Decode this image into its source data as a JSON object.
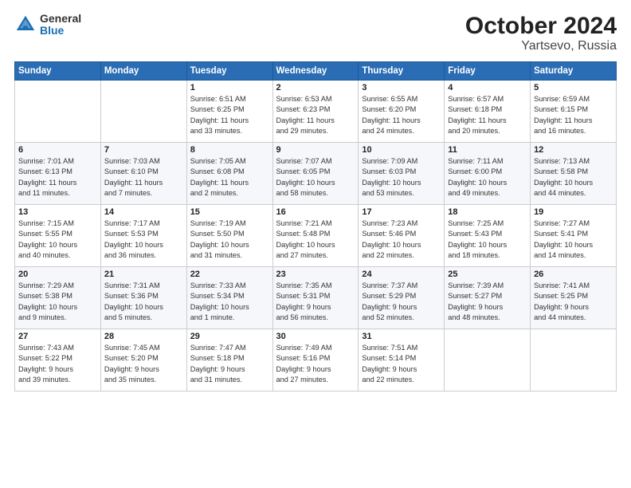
{
  "header": {
    "logo_general": "General",
    "logo_blue": "Blue",
    "title": "October 2024",
    "location": "Yartsevo, Russia"
  },
  "weekdays": [
    "Sunday",
    "Monday",
    "Tuesday",
    "Wednesday",
    "Thursday",
    "Friday",
    "Saturday"
  ],
  "weeks": [
    [
      {
        "day": "",
        "info": ""
      },
      {
        "day": "",
        "info": ""
      },
      {
        "day": "1",
        "info": "Sunrise: 6:51 AM\nSunset: 6:25 PM\nDaylight: 11 hours\nand 33 minutes."
      },
      {
        "day": "2",
        "info": "Sunrise: 6:53 AM\nSunset: 6:23 PM\nDaylight: 11 hours\nand 29 minutes."
      },
      {
        "day": "3",
        "info": "Sunrise: 6:55 AM\nSunset: 6:20 PM\nDaylight: 11 hours\nand 24 minutes."
      },
      {
        "day": "4",
        "info": "Sunrise: 6:57 AM\nSunset: 6:18 PM\nDaylight: 11 hours\nand 20 minutes."
      },
      {
        "day": "5",
        "info": "Sunrise: 6:59 AM\nSunset: 6:15 PM\nDaylight: 11 hours\nand 16 minutes."
      }
    ],
    [
      {
        "day": "6",
        "info": "Sunrise: 7:01 AM\nSunset: 6:13 PM\nDaylight: 11 hours\nand 11 minutes."
      },
      {
        "day": "7",
        "info": "Sunrise: 7:03 AM\nSunset: 6:10 PM\nDaylight: 11 hours\nand 7 minutes."
      },
      {
        "day": "8",
        "info": "Sunrise: 7:05 AM\nSunset: 6:08 PM\nDaylight: 11 hours\nand 2 minutes."
      },
      {
        "day": "9",
        "info": "Sunrise: 7:07 AM\nSunset: 6:05 PM\nDaylight: 10 hours\nand 58 minutes."
      },
      {
        "day": "10",
        "info": "Sunrise: 7:09 AM\nSunset: 6:03 PM\nDaylight: 10 hours\nand 53 minutes."
      },
      {
        "day": "11",
        "info": "Sunrise: 7:11 AM\nSunset: 6:00 PM\nDaylight: 10 hours\nand 49 minutes."
      },
      {
        "day": "12",
        "info": "Sunrise: 7:13 AM\nSunset: 5:58 PM\nDaylight: 10 hours\nand 44 minutes."
      }
    ],
    [
      {
        "day": "13",
        "info": "Sunrise: 7:15 AM\nSunset: 5:55 PM\nDaylight: 10 hours\nand 40 minutes."
      },
      {
        "day": "14",
        "info": "Sunrise: 7:17 AM\nSunset: 5:53 PM\nDaylight: 10 hours\nand 36 minutes."
      },
      {
        "day": "15",
        "info": "Sunrise: 7:19 AM\nSunset: 5:50 PM\nDaylight: 10 hours\nand 31 minutes."
      },
      {
        "day": "16",
        "info": "Sunrise: 7:21 AM\nSunset: 5:48 PM\nDaylight: 10 hours\nand 27 minutes."
      },
      {
        "day": "17",
        "info": "Sunrise: 7:23 AM\nSunset: 5:46 PM\nDaylight: 10 hours\nand 22 minutes."
      },
      {
        "day": "18",
        "info": "Sunrise: 7:25 AM\nSunset: 5:43 PM\nDaylight: 10 hours\nand 18 minutes."
      },
      {
        "day": "19",
        "info": "Sunrise: 7:27 AM\nSunset: 5:41 PM\nDaylight: 10 hours\nand 14 minutes."
      }
    ],
    [
      {
        "day": "20",
        "info": "Sunrise: 7:29 AM\nSunset: 5:38 PM\nDaylight: 10 hours\nand 9 minutes."
      },
      {
        "day": "21",
        "info": "Sunrise: 7:31 AM\nSunset: 5:36 PM\nDaylight: 10 hours\nand 5 minutes."
      },
      {
        "day": "22",
        "info": "Sunrise: 7:33 AM\nSunset: 5:34 PM\nDaylight: 10 hours\nand 1 minute."
      },
      {
        "day": "23",
        "info": "Sunrise: 7:35 AM\nSunset: 5:31 PM\nDaylight: 9 hours\nand 56 minutes."
      },
      {
        "day": "24",
        "info": "Sunrise: 7:37 AM\nSunset: 5:29 PM\nDaylight: 9 hours\nand 52 minutes."
      },
      {
        "day": "25",
        "info": "Sunrise: 7:39 AM\nSunset: 5:27 PM\nDaylight: 9 hours\nand 48 minutes."
      },
      {
        "day": "26",
        "info": "Sunrise: 7:41 AM\nSunset: 5:25 PM\nDaylight: 9 hours\nand 44 minutes."
      }
    ],
    [
      {
        "day": "27",
        "info": "Sunrise: 7:43 AM\nSunset: 5:22 PM\nDaylight: 9 hours\nand 39 minutes."
      },
      {
        "day": "28",
        "info": "Sunrise: 7:45 AM\nSunset: 5:20 PM\nDaylight: 9 hours\nand 35 minutes."
      },
      {
        "day": "29",
        "info": "Sunrise: 7:47 AM\nSunset: 5:18 PM\nDaylight: 9 hours\nand 31 minutes."
      },
      {
        "day": "30",
        "info": "Sunrise: 7:49 AM\nSunset: 5:16 PM\nDaylight: 9 hours\nand 27 minutes."
      },
      {
        "day": "31",
        "info": "Sunrise: 7:51 AM\nSunset: 5:14 PM\nDaylight: 9 hours\nand 22 minutes."
      },
      {
        "day": "",
        "info": ""
      },
      {
        "day": "",
        "info": ""
      }
    ]
  ]
}
